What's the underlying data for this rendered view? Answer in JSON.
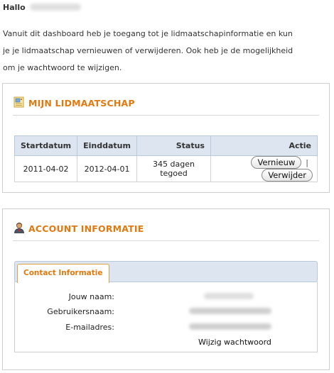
{
  "greeting": {
    "hallo": "Hallo"
  },
  "intro": {
    "line1": "Vanuit dit dashboard heb je toegang tot je lidmaatschapinformatie en kun",
    "line2": "je je lidmaatschap vernieuwen of verwijderen. Ook heb je de mogelijkheid",
    "line3": "om je wachtwoord te wijzigen."
  },
  "membership": {
    "title": "MIJN LIDMAATSCHAP",
    "icon": "membership-card-icon",
    "columns": [
      "Startdatum",
      "Einddatum",
      "Status",
      "Actie"
    ],
    "row": {
      "start": "2011-04-02",
      "end": "2012-04-01",
      "status": "345 dagen tegoed",
      "renew_label": "Vernieuw",
      "separator": "|",
      "delete_label": "Verwijder"
    }
  },
  "account": {
    "title": "ACCOUNT INFORMATIE",
    "icon": "user-icon",
    "tab_label": "Contact Informatie",
    "fields": {
      "name_label": "Jouw naam:",
      "username_label": "Gebruikersnaam:",
      "email_label": "E-mailadres:"
    },
    "change_password": "Wijzig wachtwoord"
  },
  "colors": {
    "accent": "#e07a10",
    "table_header": "#dde6f0"
  }
}
